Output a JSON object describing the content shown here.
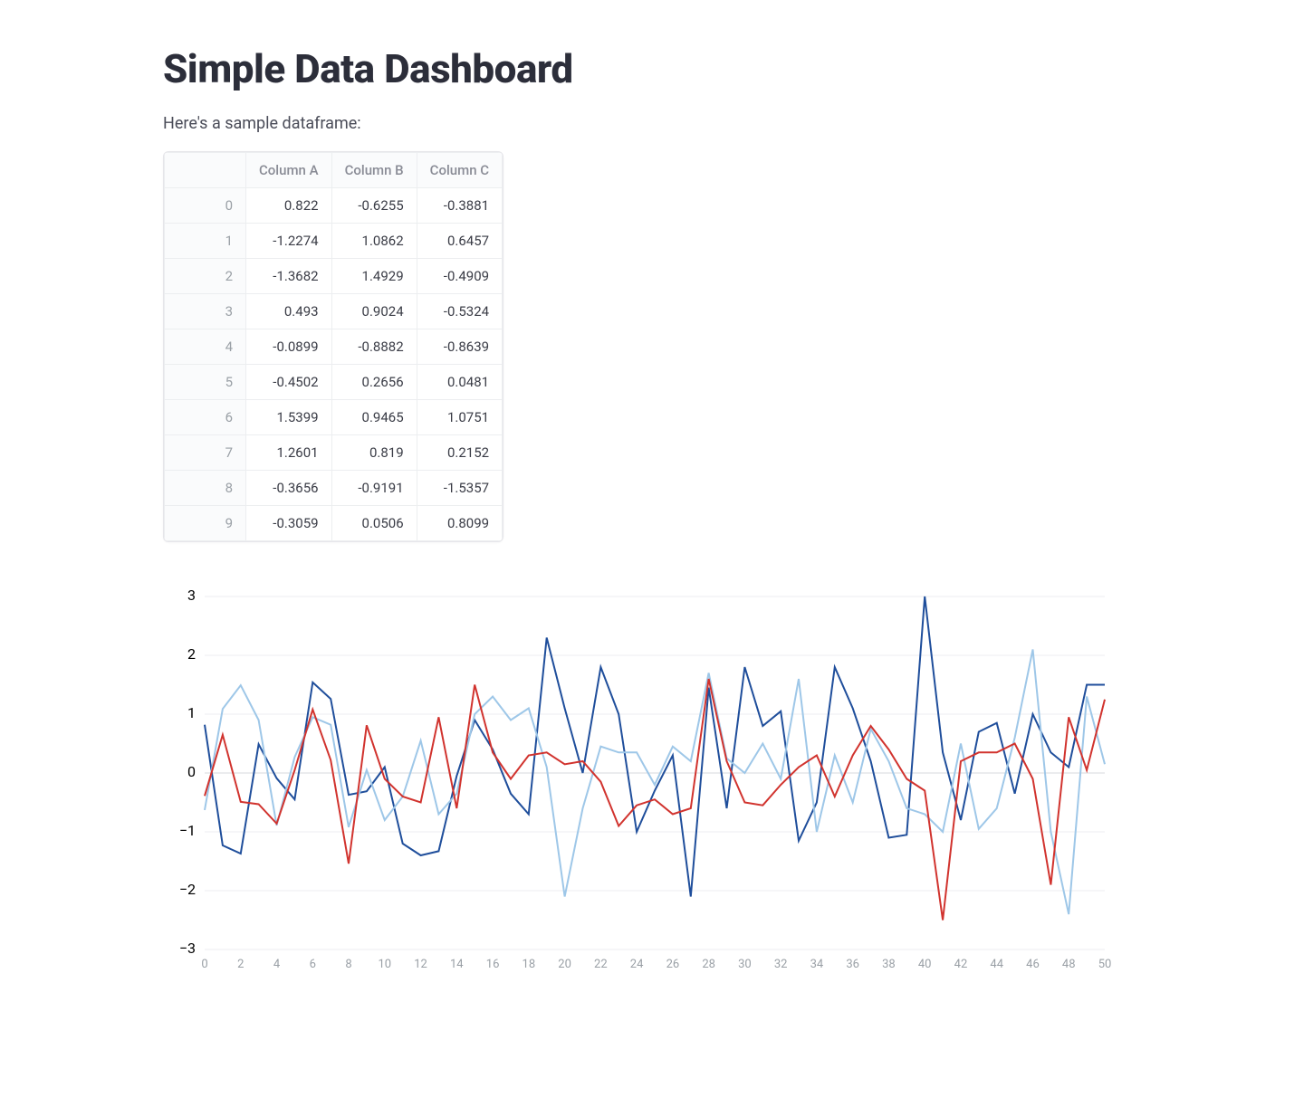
{
  "header": {
    "title": "Simple Data Dashboard",
    "caption": "Here's a sample dataframe:"
  },
  "table": {
    "index_header": "",
    "columns": [
      "Column A",
      "Column B",
      "Column C"
    ],
    "index": [
      0,
      1,
      2,
      3,
      4,
      5,
      6,
      7,
      8,
      9
    ],
    "rows": [
      [
        "0.822",
        "-0.6255",
        "-0.3881"
      ],
      [
        "-1.2274",
        "1.0862",
        "0.6457"
      ],
      [
        "-1.3682",
        "1.4929",
        "-0.4909"
      ],
      [
        "0.493",
        "0.9024",
        "-0.5324"
      ],
      [
        "-0.0899",
        "-0.8882",
        "-0.8639"
      ],
      [
        "-0.4502",
        "0.2656",
        "0.0481"
      ],
      [
        "1.5399",
        "0.9465",
        "1.0751"
      ],
      [
        "1.2601",
        "0.819",
        "0.2152"
      ],
      [
        "-0.3656",
        "-0.9191",
        "-1.5357"
      ],
      [
        "-0.3059",
        "0.0506",
        "0.8099"
      ]
    ]
  },
  "colors": {
    "series_a": "#1f4e9b",
    "series_b": "#9ec7e8",
    "series_c": "#d1332e",
    "grid": "#eceef1",
    "axis_text": "#9aa0a6"
  },
  "chart_data": {
    "type": "line",
    "xlabel": "",
    "ylabel": "",
    "xlim": [
      0,
      50
    ],
    "ylim": [
      -3,
      3
    ],
    "x_ticks": [
      0,
      2,
      4,
      6,
      8,
      10,
      12,
      14,
      16,
      18,
      20,
      22,
      24,
      26,
      28,
      30,
      32,
      34,
      36,
      38,
      40,
      42,
      44,
      46,
      48,
      50
    ],
    "y_ticks": [
      -3,
      -2,
      -1,
      0,
      1,
      2,
      3
    ],
    "x": [
      0,
      1,
      2,
      3,
      4,
      5,
      6,
      7,
      8,
      9,
      10,
      11,
      12,
      13,
      14,
      15,
      16,
      17,
      18,
      19,
      20,
      21,
      22,
      23,
      24,
      25,
      26,
      27,
      28,
      29,
      30,
      31,
      32,
      33,
      34,
      35,
      36,
      37,
      38,
      39,
      40,
      41,
      42,
      43,
      44,
      45,
      46,
      47,
      48,
      49,
      50
    ],
    "series": [
      {
        "name": "Column A",
        "color": "#1f4e9b",
        "values": [
          0.82,
          -1.23,
          -1.37,
          0.49,
          -0.09,
          -0.45,
          1.54,
          1.26,
          -0.37,
          -0.31,
          0.1,
          -1.2,
          -1.4,
          -1.33,
          -0.05,
          0.9,
          0.4,
          -0.35,
          -0.7,
          2.3,
          1.1,
          0.0,
          1.8,
          1.0,
          -1.0,
          -0.3,
          0.3,
          -2.1,
          1.45,
          -0.6,
          1.8,
          0.8,
          1.05,
          -1.15,
          -0.5,
          1.8,
          1.1,
          0.2,
          -1.1,
          -1.05,
          3.0,
          0.35,
          -0.8,
          0.7,
          0.85,
          -0.35,
          1.0,
          0.35,
          0.1,
          1.5,
          1.5
        ]
      },
      {
        "name": "Column B",
        "color": "#9ec7e8",
        "values": [
          -0.63,
          1.09,
          1.49,
          0.9,
          -0.89,
          0.27,
          0.95,
          0.82,
          -0.92,
          0.05,
          -0.8,
          -0.4,
          0.55,
          -0.7,
          -0.35,
          1.0,
          1.3,
          0.9,
          1.1,
          0.1,
          -2.1,
          -0.6,
          0.45,
          0.35,
          0.35,
          -0.2,
          0.45,
          0.2,
          1.7,
          0.25,
          0.0,
          0.5,
          -0.1,
          1.6,
          -1.0,
          0.3,
          -0.5,
          0.75,
          0.2,
          -0.6,
          -0.7,
          -1.0,
          0.5,
          -0.95,
          -0.6,
          0.6,
          2.1,
          -1.0,
          -2.4,
          1.3,
          0.15
        ]
      },
      {
        "name": "Column C",
        "color": "#d1332e",
        "values": [
          -0.39,
          0.65,
          -0.49,
          -0.53,
          -0.86,
          0.05,
          1.08,
          0.22,
          -1.54,
          0.81,
          -0.1,
          -0.4,
          -0.5,
          0.95,
          -0.6,
          1.5,
          0.35,
          -0.1,
          0.3,
          0.35,
          0.15,
          0.2,
          -0.15,
          -0.9,
          -0.55,
          -0.45,
          -0.7,
          -0.6,
          1.6,
          0.2,
          -0.5,
          -0.55,
          -0.2,
          0.1,
          0.3,
          -0.4,
          0.3,
          0.8,
          0.4,
          -0.1,
          -0.3,
          -2.5,
          0.2,
          0.35,
          0.35,
          0.5,
          -0.1,
          -1.9,
          0.95,
          0.05,
          1.25
        ]
      }
    ]
  }
}
